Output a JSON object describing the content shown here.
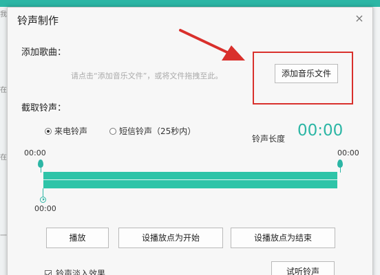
{
  "dialog": {
    "title": "铃声制作",
    "close_glyph": "×"
  },
  "add_song": {
    "label": "添加歌曲：",
    "hint": "请点击“添加音乐文件”，或将文件拖拽至此。",
    "button_label": "添加音乐文件"
  },
  "trim": {
    "label": "截取铃声：",
    "options": [
      {
        "label": "来电铃声",
        "selected": true
      },
      {
        "label": "短信铃声（25秒内）",
        "selected": false
      }
    ],
    "length_label": "铃声长度",
    "length_value": "00:00",
    "start_time": "00:00",
    "end_time": "00:00",
    "cursor_time": "00:00"
  },
  "controls": {
    "play_label": "播放",
    "set_start_label": "设播放点为开始",
    "set_end_label": "设播放点为结束"
  },
  "footer": {
    "fade_label": "铃声淡入效果",
    "fade_checked": true,
    "preview_label": "试听铃声"
  },
  "background": {
    "left_chars": [
      "我",
      "在",
      "在",
      "一"
    ]
  },
  "colors": {
    "accent": "#2cb6a5",
    "annotation": "#d9302c"
  }
}
